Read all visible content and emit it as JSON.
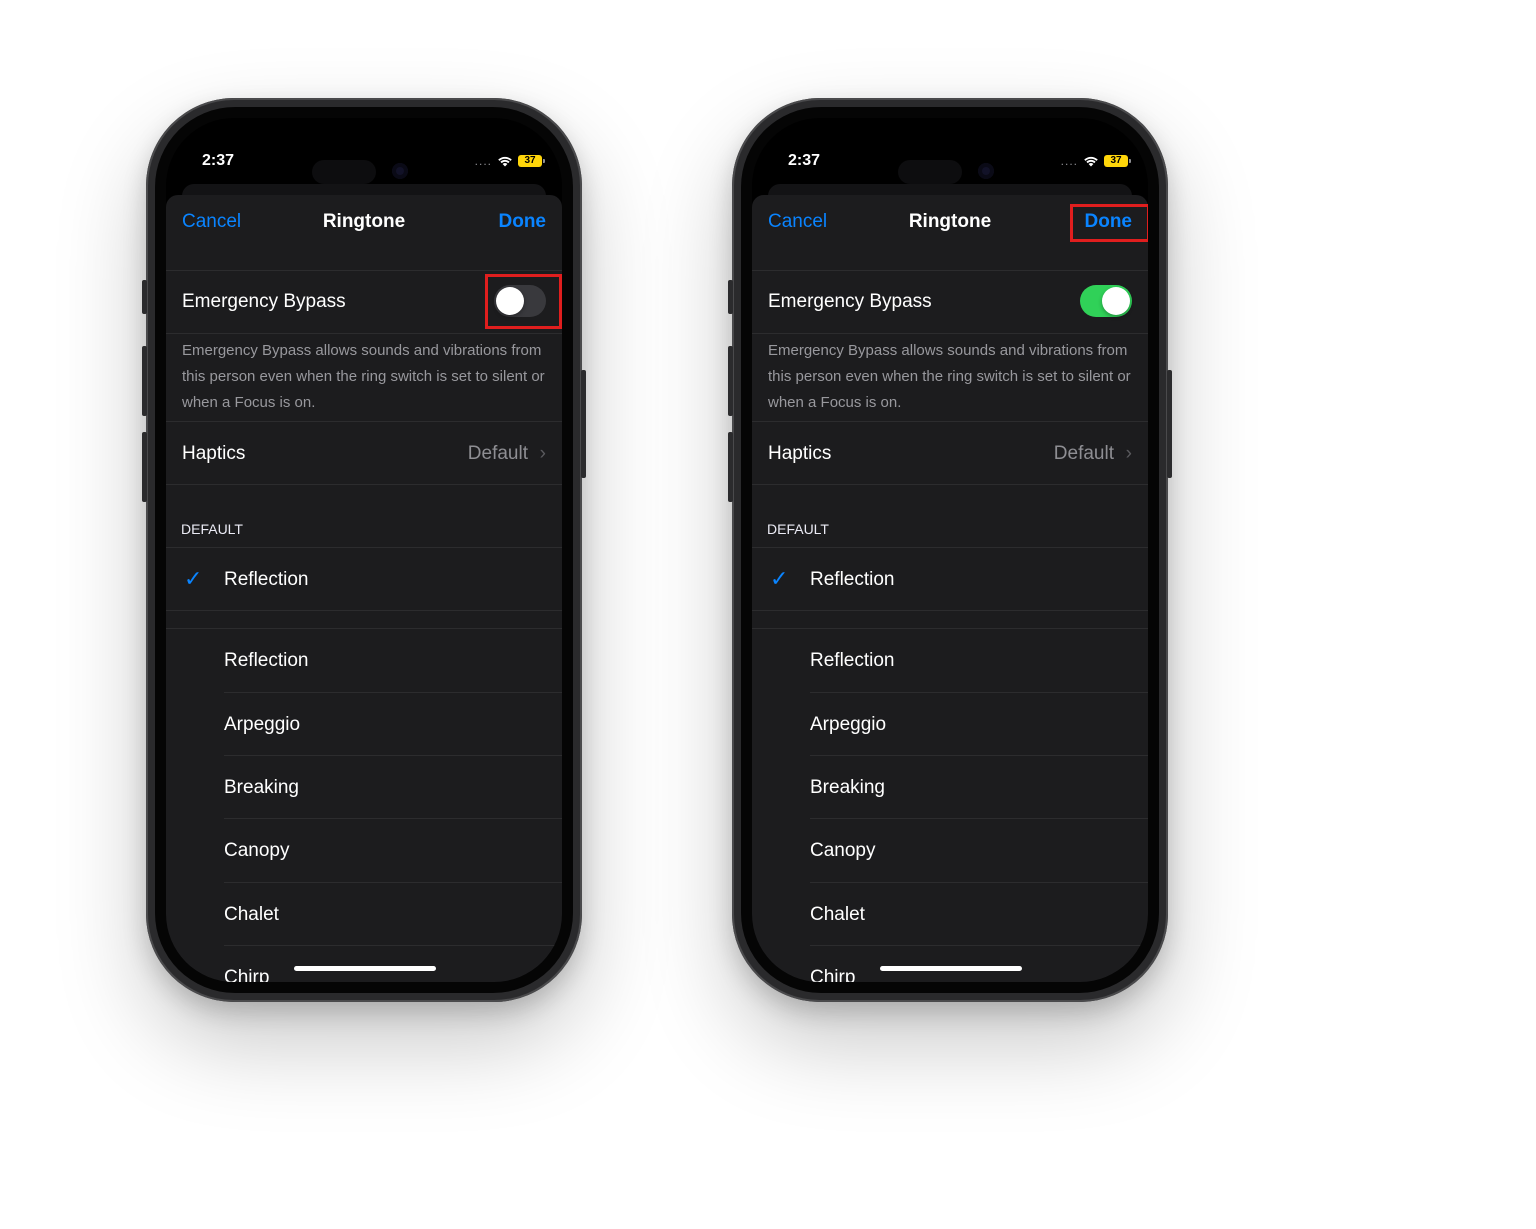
{
  "colors": {
    "accent": "#0a84ff",
    "toggle_on": "#30d158",
    "toggle_off": "#39393d",
    "highlight": "#e01e1e",
    "battery": "#ffd60a",
    "sheet_bg": "#1c1c1e"
  },
  "phones": [
    {
      "status": {
        "time": "2:37",
        "signal": "....",
        "wifi_icon": "wifi-icon",
        "battery": "37"
      },
      "nav": {
        "cancel": "Cancel",
        "title": "Ringtone",
        "done": "Done"
      },
      "emergency_bypass": {
        "label": "Emergency Bypass",
        "enabled": false,
        "footnote": "Emergency Bypass allows sounds and vibrations from this person even when the ring switch is set to silent or when a Focus is on."
      },
      "haptics": {
        "label": "Haptics",
        "value": "Default",
        "chevron": "›"
      },
      "section_header": "DEFAULT",
      "selected_tone": {
        "check": "✓",
        "label": "Reflection"
      },
      "tones": [
        "Reflection",
        "Arpeggio",
        "Breaking",
        "Canopy",
        "Chalet",
        "Chirp"
      ],
      "highlighted": "emergency-bypass-toggle"
    },
    {
      "status": {
        "time": "2:37",
        "signal": "....",
        "wifi_icon": "wifi-icon",
        "battery": "37"
      },
      "nav": {
        "cancel": "Cancel",
        "title": "Ringtone",
        "done": "Done"
      },
      "emergency_bypass": {
        "label": "Emergency Bypass",
        "enabled": true,
        "footnote": "Emergency Bypass allows sounds and vibrations from this person even when the ring switch is set to silent or when a Focus is on."
      },
      "haptics": {
        "label": "Haptics",
        "value": "Default",
        "chevron": "›"
      },
      "section_header": "DEFAULT",
      "selected_tone": {
        "check": "✓",
        "label": "Reflection"
      },
      "tones": [
        "Reflection",
        "Arpeggio",
        "Breaking",
        "Canopy",
        "Chalet",
        "Chirp"
      ],
      "highlighted": "done-button"
    }
  ]
}
